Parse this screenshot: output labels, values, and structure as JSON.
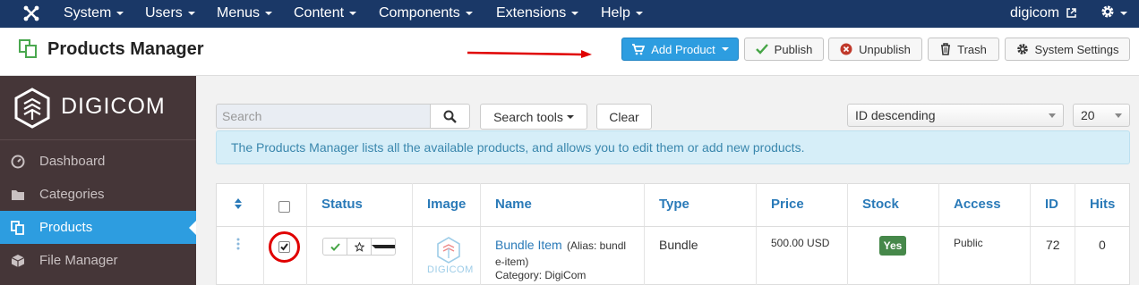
{
  "topnav": {
    "menus": [
      {
        "label": "System"
      },
      {
        "label": "Users"
      },
      {
        "label": "Menus"
      },
      {
        "label": "Content"
      },
      {
        "label": "Components"
      },
      {
        "label": "Extensions"
      },
      {
        "label": "Help"
      }
    ],
    "site_name": "digicom",
    "bg_color": "#1a3867"
  },
  "toolbar": {
    "title": "Products Manager",
    "add_product": "Add Product",
    "publish": "Publish",
    "unpublish": "Unpublish",
    "trash": "Trash",
    "system_settings": "System Settings"
  },
  "sidebar": {
    "logo_text": "DIGICOM",
    "items": [
      {
        "label": "Dashboard",
        "icon": "dashboard-icon"
      },
      {
        "label": "Categories",
        "icon": "folder-icon"
      },
      {
        "label": "Products",
        "icon": "products-icon",
        "active": true
      },
      {
        "label": "File Manager",
        "icon": "cube-icon"
      }
    ],
    "accent": "#2d9de0"
  },
  "filters": {
    "search_placeholder": "Search",
    "search_tools": "Search tools",
    "clear": "Clear",
    "ordering": "ID descending",
    "limit": "20"
  },
  "info_message": "The Products Manager lists all the available products, and allows you to edit them or add new products.",
  "table": {
    "headers": {
      "status": "Status",
      "image": "Image",
      "name": "Name",
      "type": "Type",
      "price": "Price",
      "stock": "Stock",
      "access": "Access",
      "id": "ID",
      "hits": "Hits"
    },
    "rows": [
      {
        "name": "Bundle Item",
        "alias_line1": "(Alias: bundl",
        "alias_line2": "e-item)",
        "category": "Category: DigiCom",
        "image_caption": "DIGICOM",
        "type": "Bundle",
        "price": "500.00 USD",
        "stock": "Yes",
        "access": "Public",
        "id": "72",
        "hits": "0",
        "checked": true
      }
    ]
  }
}
